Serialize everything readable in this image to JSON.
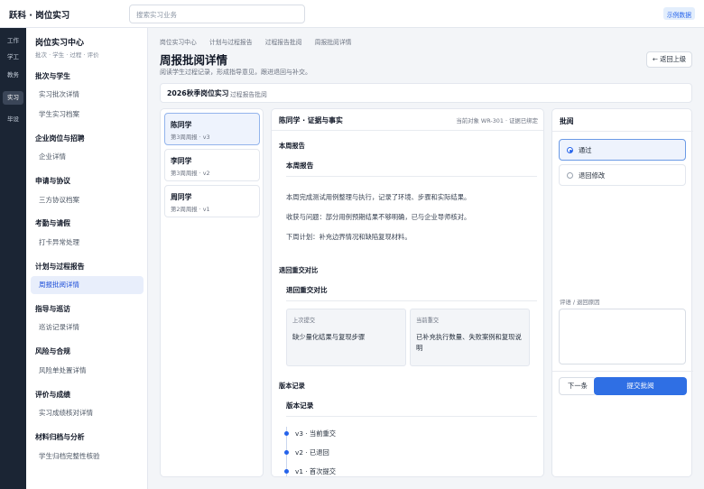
{
  "app": {
    "brand": "跃科 · 岗位实习",
    "demo_badge": "示例数据"
  },
  "search": {
    "placeholder": "搜索实习业务"
  },
  "rail": [
    "工作",
    "学工",
    "教务",
    "实习",
    "毕设"
  ],
  "sidebar": {
    "title": "岗位实习中心",
    "subtitle": "批次 · 学生 · 过程 · 评价",
    "groups": [
      {
        "label": "批次与学生",
        "items": [
          "实习批次详情",
          "学生实习档案"
        ]
      },
      {
        "label": "企业岗位与招聘",
        "items": [
          "企业详情"
        ]
      },
      {
        "label": "申请与协议",
        "items": [
          "三方协议档案"
        ]
      },
      {
        "label": "考勤与请假",
        "items": [
          "打卡异常处理"
        ]
      },
      {
        "label": "计划与过程报告",
        "items": [
          "周报批阅详情"
        ]
      },
      {
        "label": "指导与巡访",
        "items": [
          "巡访记录详情"
        ]
      },
      {
        "label": "风险与合规",
        "items": [
          "风险单处置详情"
        ]
      },
      {
        "label": "评价与成绩",
        "items": [
          "实习成绩核对详情"
        ]
      },
      {
        "label": "材料归档与分析",
        "items": [
          "学生归档完整性核验"
        ]
      }
    ]
  },
  "breadcrumb": [
    "岗位实习中心",
    "计划与过程报告",
    "过程报告批阅",
    "周报批阅详情"
  ],
  "page": {
    "title": "周报批阅详情",
    "description": "阅读学生过程记录，形成指导意见，跟进退回与补交。",
    "back_label": "← 返回上级"
  },
  "context": {
    "batch": "2026秋季岗位实习",
    "tag": "过程报告批阅"
  },
  "students": [
    {
      "name": "陈同学",
      "meta": "第3周周报 · v3"
    },
    {
      "name": "李同学",
      "meta": "第3周周报 · v2"
    },
    {
      "name": "周同学",
      "meta": "第2周周报 · v1"
    }
  ],
  "evidence": {
    "title": "陈同学 · 证据与事实",
    "status": "当前对象 WR-301 · 证据已绑定",
    "weekly": {
      "label": "本周报告",
      "heading": "本周报告",
      "paragraphs": [
        "本周完成测试用例整理与执行，记录了环境、步骤和实际结果。",
        "收获与问题：部分用例预期结果不够明确，已与企业导师核对。",
        "下周计划：补充边界情况和缺陷复现材料。"
      ]
    },
    "compare": {
      "label": "退回重交对比",
      "heading": "退回重交对比",
      "previous_label": "上次提交",
      "previous_text": "缺少量化结果与复现步骤",
      "current_label": "当前重交",
      "current_text": "已补充执行数量、失败案例和复现说明"
    },
    "versions": {
      "label": "版本记录",
      "heading": "版本记录",
      "items": [
        "v3 · 当前重交",
        "v2 · 已退回",
        "v1 · 首次提交"
      ]
    }
  },
  "review": {
    "title": "批阅",
    "options": [
      "通过",
      "退回修改"
    ],
    "selected": "通过",
    "comment_label": "评语 / 退回原因",
    "comment_value": "",
    "next_label": "下一条",
    "submit_label": "提交批阅"
  },
  "colors": {
    "accent": "#2f6fe4",
    "rail": "#1b2534",
    "active_bg": "#e8eefb"
  }
}
